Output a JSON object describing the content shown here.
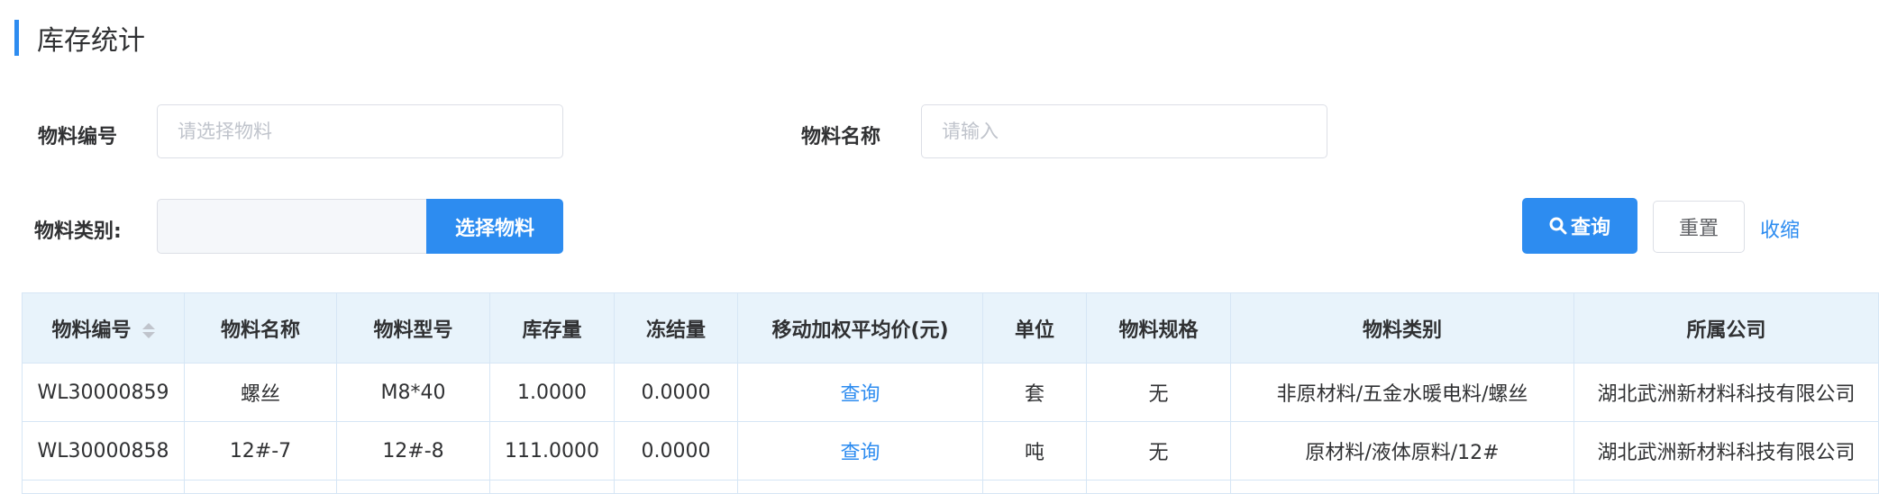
{
  "page": {
    "title": "库存统计"
  },
  "search": {
    "material_code_label": "物料编号",
    "material_code_placeholder": "请选择物料",
    "material_name_label": "物料名称",
    "material_name_placeholder": "请输入",
    "material_category_label": "物料类别:",
    "material_category_value": "",
    "select_material_button": "选择物料",
    "query_button": "查询",
    "reset_button": "重置",
    "collapse_link": "收缩"
  },
  "table": {
    "columns": [
      "物料编号",
      "物料名称",
      "物料型号",
      "库存量",
      "冻结量",
      "移动加权平均价(元)",
      "单位",
      "物料规格",
      "物料类别",
      "所属公司"
    ],
    "rows": [
      {
        "code": "WL30000859",
        "name": "螺丝",
        "model": "M8*40",
        "stock": "1.0000",
        "frozen": "0.0000",
        "avg_price": "查询",
        "unit": "套",
        "spec": "无",
        "category": "非原材料/五金水暖电料/螺丝",
        "company": "湖北武洲新材料科技有限公司"
      },
      {
        "code": "WL30000858",
        "name": "12#-7",
        "model": "12#-8",
        "stock": "111.0000",
        "frozen": "0.0000",
        "avg_price": "查询",
        "unit": "吨",
        "spec": "无",
        "category": "原材料/液体原料/12#",
        "company": "湖北武洲新材料科技有限公司"
      }
    ]
  }
}
